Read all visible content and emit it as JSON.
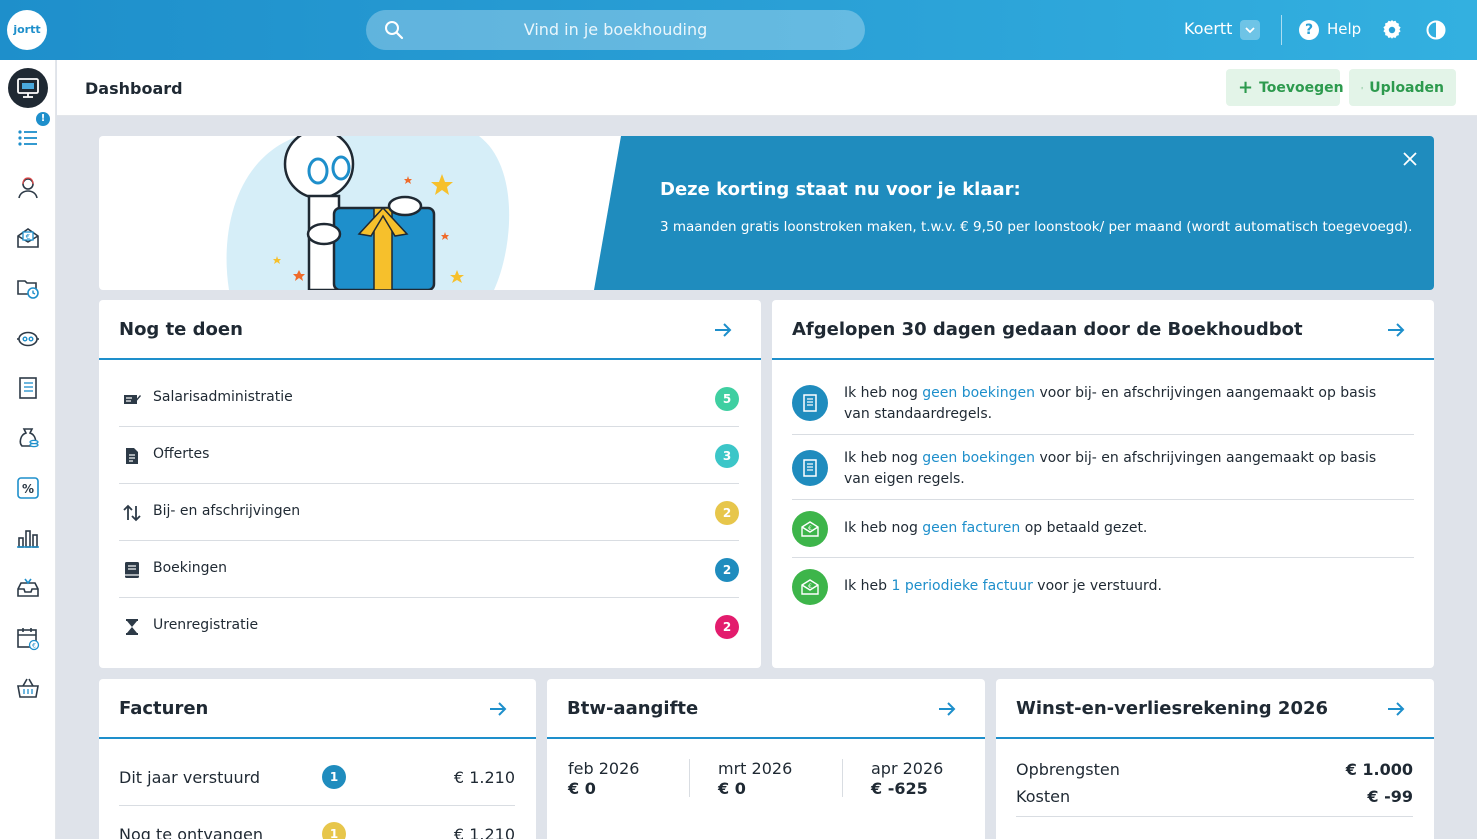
{
  "topbar": {
    "logo": "jortt",
    "search_placeholder": "Vind in je boekhouding",
    "user_name": "Koertt",
    "help_label": "Help"
  },
  "sidebar": {
    "items": [
      {
        "name": "dashboard",
        "icon": "monitor-icon",
        "active": true
      },
      {
        "name": "tasks",
        "icon": "list-icon",
        "badge": "!"
      },
      {
        "name": "contacts",
        "icon": "person-icon"
      },
      {
        "name": "invoices",
        "icon": "euro-mail-icon"
      },
      {
        "name": "hours",
        "icon": "folder-clock-icon"
      },
      {
        "name": "bookkeeping-bot",
        "icon": "robot-icon"
      },
      {
        "name": "ledger",
        "icon": "book-icon"
      },
      {
        "name": "finance",
        "icon": "money-bag-icon"
      },
      {
        "name": "vat",
        "icon": "percent-icon"
      },
      {
        "name": "reports",
        "icon": "bar-chart-icon"
      },
      {
        "name": "inbox",
        "icon": "inbox-icon"
      },
      {
        "name": "payroll",
        "icon": "calendar-euro-icon"
      },
      {
        "name": "shop",
        "icon": "basket-icon"
      }
    ]
  },
  "header": {
    "title": "Dashboard",
    "add_label": "Toevoegen",
    "upload_label": "Uploaden"
  },
  "banner": {
    "title": "Deze korting staat nu voor je klaar:",
    "text": "3 maanden gratis loonstroken maken, t.w.v. € 9,50 per loonstook/ per maand (wordt automatisch toegevoegd)."
  },
  "todo": {
    "title": "Nog te doen",
    "items": [
      {
        "label": "Salarisadministratie",
        "count": "5",
        "color": "#3fcfa1",
        "icon": "payroll-edit-icon"
      },
      {
        "label": "Offertes",
        "count": "3",
        "color": "#3cc6c8",
        "icon": "document-icon"
      },
      {
        "label": "Bij- en afschrijvingen",
        "count": "2",
        "color": "#e7c64b",
        "icon": "transfer-arrows-icon"
      },
      {
        "label": "Boekingen",
        "count": "2",
        "color": "#1f8cbe",
        "icon": "book-icon"
      },
      {
        "label": "Urenregistratie",
        "count": "2",
        "color": "#e31c6d",
        "icon": "hourglass-icon"
      }
    ]
  },
  "bot": {
    "title": "Afgelopen 30 dagen gedaan door de Boekhoudbot",
    "items": [
      {
        "pre": "Ik heb nog ",
        "link": "geen boekingen",
        "post": " voor bij- en afschrijvingen aangemaakt op basis van standaardregels.",
        "color": "#1f8cbe",
        "icon": "ledger-icon"
      },
      {
        "pre": "Ik heb nog ",
        "link": "geen boekingen",
        "post": " voor bij- en afschrijvingen aangemaakt op basis van eigen regels.",
        "color": "#1f8cbe",
        "icon": "ledger-icon"
      },
      {
        "pre": "Ik heb nog ",
        "link": "geen facturen",
        "post": " op betaald gezet.",
        "color": "#3db54a",
        "icon": "euro-mail-icon"
      },
      {
        "pre": "Ik heb ",
        "link": "1 periodieke factuur",
        "post": " voor je verstuurd.",
        "color": "#3db54a",
        "icon": "euro-mail-icon"
      }
    ]
  },
  "facturen": {
    "title": "Facturen",
    "rows": [
      {
        "label": "Dit jaar verstuurd",
        "count": "1",
        "color": "#1f8cbe",
        "value": "€ 1.210"
      },
      {
        "label": "Nog te ontvangen",
        "count": "1",
        "color": "#e7c64b",
        "value": "€ 1.210"
      }
    ]
  },
  "btw": {
    "title": "Btw-aangifte",
    "periods": [
      {
        "month": "feb 2026",
        "value": "€ 0"
      },
      {
        "month": "mrt 2026",
        "value": "€ 0"
      },
      {
        "month": "apr 2026",
        "value": "€ -625"
      }
    ]
  },
  "winst": {
    "title": "Winst-en-verliesrekening 2026",
    "rows": [
      {
        "label": "Opbrengsten",
        "value": "€ 1.000"
      },
      {
        "label": "Kosten",
        "value": "€ -99"
      }
    ]
  }
}
